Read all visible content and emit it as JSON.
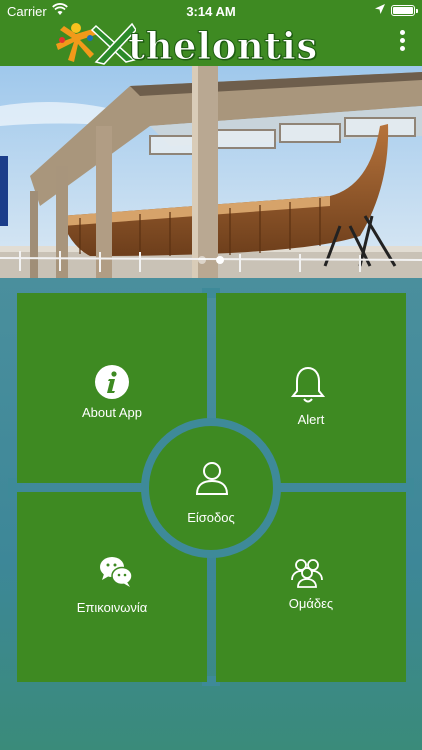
{
  "status_bar": {
    "carrier": "Carrier",
    "time": "3:14 AM"
  },
  "header": {
    "logo_text": "thelontis"
  },
  "banner": {
    "slides": 2,
    "active_slide": 2
  },
  "menu": {
    "about": "About App",
    "alert": "Alert",
    "login": "Είσοδος",
    "contact": "Επικοινωνία",
    "groups": "Ομάδες"
  },
  "colors": {
    "primary_green": "#3e8a22",
    "teal": "#3e8a99"
  },
  "icons": [
    "wifi-icon",
    "location-icon",
    "battery-icon",
    "more-vertical-icon",
    "info-icon",
    "bell-icon",
    "user-icon",
    "chat-bubbles-icon",
    "group-icon"
  ]
}
